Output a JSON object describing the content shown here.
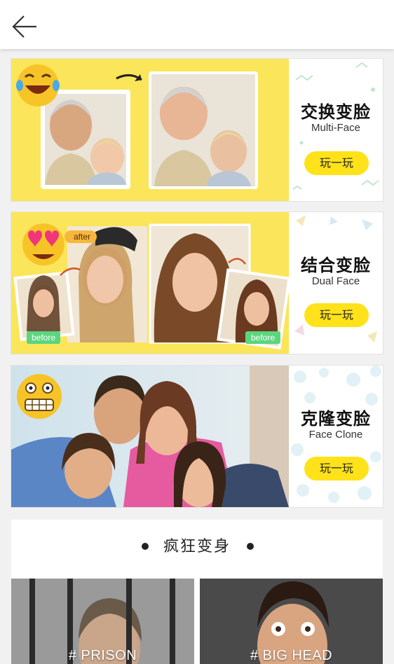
{
  "header": {
    "back_icon": "arrow-left-icon"
  },
  "cards": [
    {
      "title_cn": "交换变脸",
      "title_en": "Multi-Face",
      "button": "玩一玩",
      "emoji": "laughing-tears-emoji"
    },
    {
      "title_cn": "结合变脸",
      "title_en": "Dual Face",
      "button": "玩一玩",
      "emoji": "heart-eyes-emoji",
      "tag_after": "after",
      "tag_before_left": "before",
      "tag_before_right": "before"
    },
    {
      "title_cn": "克隆变脸",
      "title_en": "Face Clone",
      "button": "玩一玩",
      "emoji": "grimacing-emoji"
    }
  ],
  "section": {
    "title": "疯狂变身",
    "tiles": [
      {
        "label": "# PRISON"
      },
      {
        "label": "# BIG HEAD"
      }
    ]
  },
  "colors": {
    "accent_yellow": "#ffe21a",
    "banner_yellow": "#fbe55a",
    "page_bg": "#f1f1f1"
  }
}
